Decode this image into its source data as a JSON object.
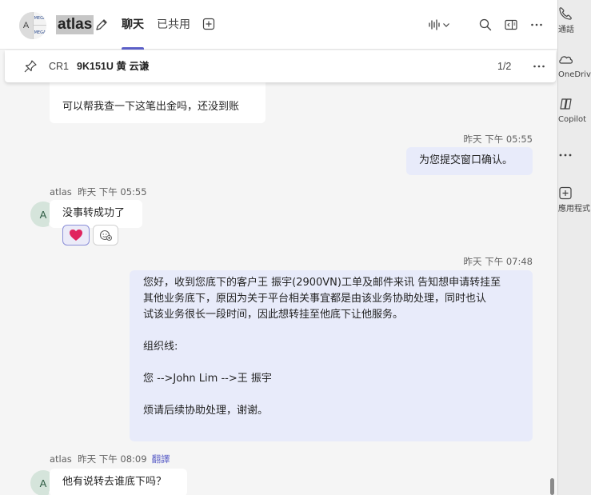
{
  "header": {
    "title": "atlas",
    "avatar_letter": "A",
    "avatar_tile_text": "MEGA",
    "tabs": [
      {
        "label": "聊天",
        "active": true
      },
      {
        "label": "已共用",
        "active": false
      }
    ]
  },
  "pinned": {
    "prefix": "CR1",
    "text": "9K151U 黄 云谦",
    "count": "1/2"
  },
  "messages": {
    "m1": {
      "text": "可以帮我查一下这笔出金吗，还没到账"
    },
    "m2": {
      "timestamp": "昨天 下午 05:55",
      "text": "为您提交窗口确认。"
    },
    "m3": {
      "sender": "atlas",
      "timestamp": "昨天 下午 05:55",
      "avatar": "A",
      "text": "没事转成功了"
    },
    "m4": {
      "timestamp": "昨天 下午 07:48",
      "lines": [
        "您好，收到您底下的客户王 振宇(2900VN)工单及邮件来讯 告知想申请转挂至",
        "其他业务底下，原因为关于平台相关事宜都是由该业务协助处理，同时也认",
        "试该业务很长一段时间，因此想转挂至他底下让他服务。",
        "",
        "组织线:",
        "",
        "您 -->John Lim -->王 振宇",
        "",
        "烦请后续协助处理，谢谢。"
      ]
    },
    "m5": {
      "sender": "atlas",
      "timestamp": "昨天 下午 08:09",
      "translate": "翻譯",
      "avatar": "A",
      "text": "他有说转去谁底下吗？"
    }
  },
  "reactions": {
    "heart": "heart-reaction",
    "add": "add-reaction"
  },
  "rail": {
    "items": [
      {
        "label": "通話",
        "icon": "phone-icon"
      },
      {
        "label": "OneDrive",
        "icon": "cloud-icon"
      },
      {
        "label": "Copilot",
        "icon": "copilot-icon"
      },
      {
        "label": "",
        "icon": "more-icon"
      },
      {
        "label": "應用程式",
        "icon": "add-app-icon"
      }
    ]
  },
  "colors": {
    "accent": "#5b5fc7",
    "outgoing_bubble": "#e8ebfa",
    "presence_away": "#eaa300",
    "reaction_heart": "#e0245e"
  }
}
